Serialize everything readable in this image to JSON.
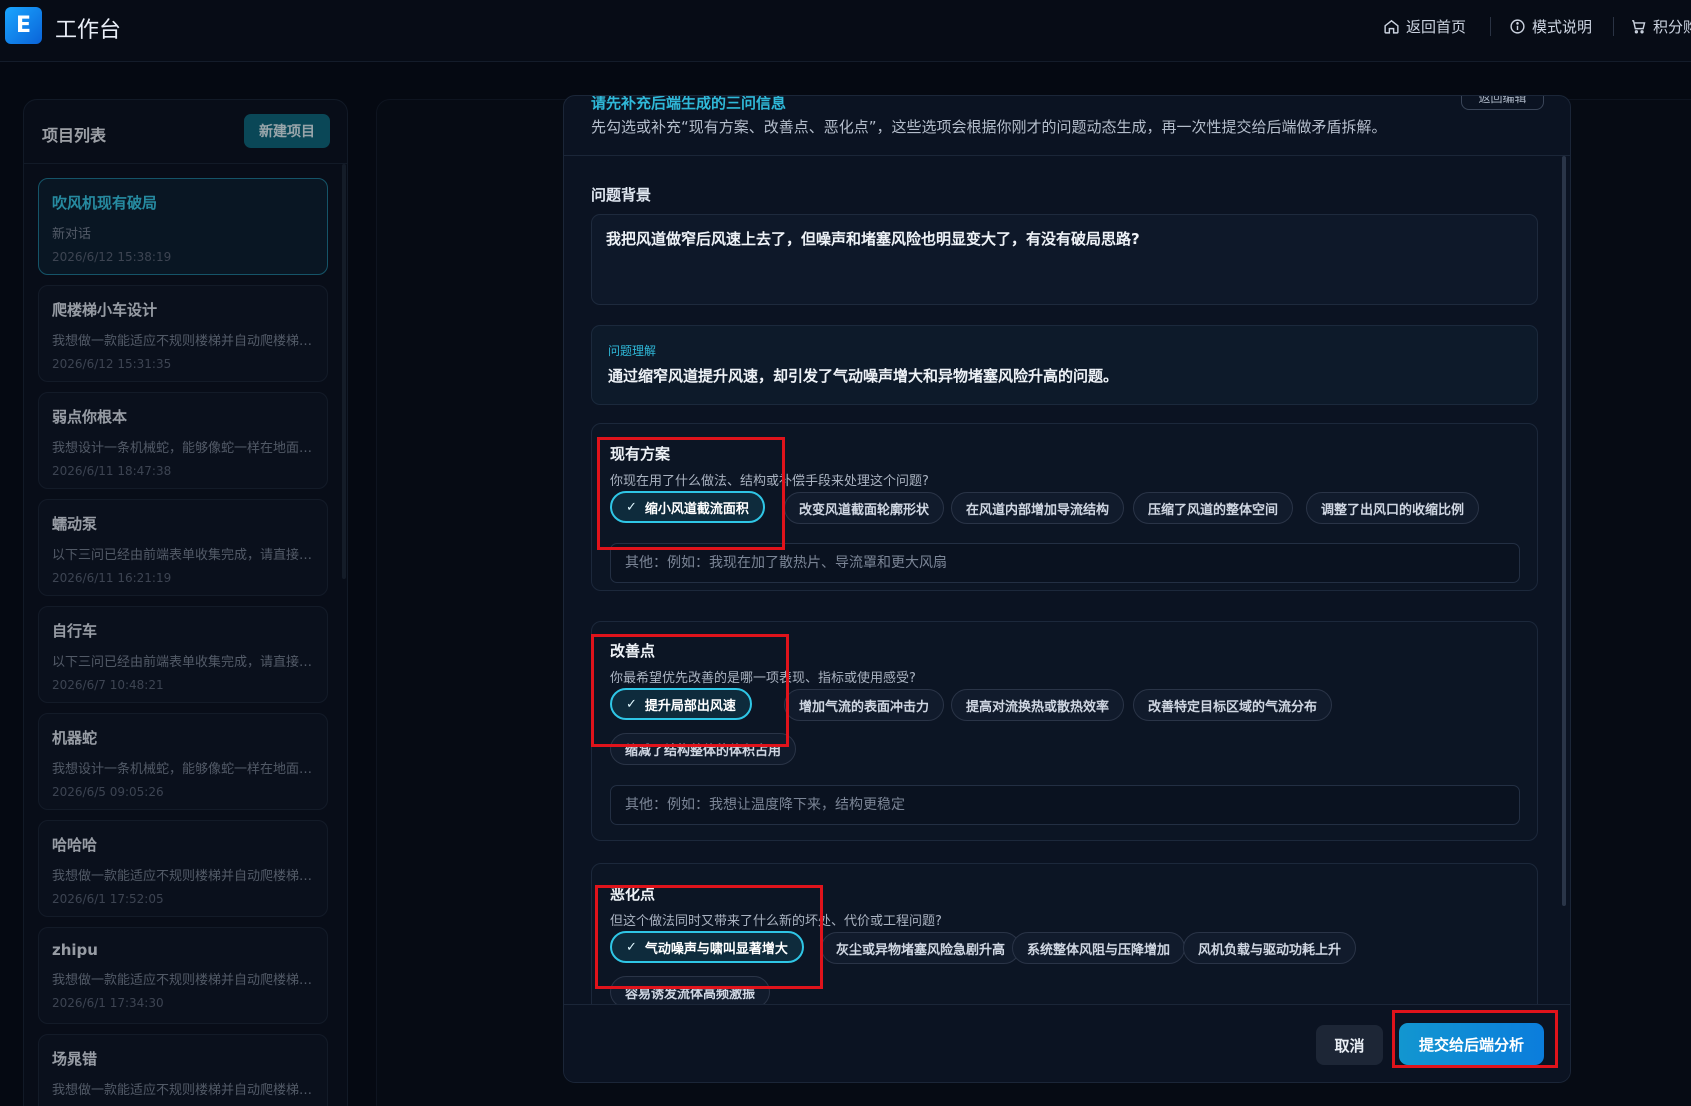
{
  "header": {
    "logo_letter": "E",
    "title": "工作台",
    "nav": {
      "home": "返回首页",
      "mode": "模式说明",
      "points": "积分购"
    }
  },
  "sidebar": {
    "title": "项目列表",
    "new_button": "新建项目",
    "projects": [
      {
        "name": "吹风机现有破局",
        "desc": "新对话",
        "time": "2026/6/12 15:38:19"
      },
      {
        "name": "爬楼梯小车设计",
        "desc": "我想做一款能适应不规则楼梯并自动爬楼梯的小车…",
        "time": "2026/6/12 15:31:35"
      },
      {
        "name": "弱点你根本",
        "desc": "我想设计一条机械蛇，能够像蛇一样在地面上爬行…",
        "time": "2026/6/11 18:47:38"
      },
      {
        "name": "蠕动泵",
        "desc": "以下三问已经由前端表单收集完成，请直接进入分析…",
        "time": "2026/6/11 16:21:19"
      },
      {
        "name": "自行车",
        "desc": "以下三问已经由前端表单收集完成，请直接进入分析…",
        "time": "2026/6/7 10:48:21"
      },
      {
        "name": "机器蛇",
        "desc": "我想设计一条机械蛇，能够像蛇一样在地面上爬行…",
        "time": "2026/6/5 09:05:26"
      },
      {
        "name": "哈哈哈",
        "desc": "我想做一款能适应不规则楼梯并自动爬楼梯的小车…",
        "time": "2026/6/1 17:52:05"
      },
      {
        "name": "zhipu",
        "desc": "我想做一款能适应不规则楼梯并自动爬楼梯的小车…",
        "time": "2026/6/1 17:34:30"
      },
      {
        "name": "场晁错",
        "desc": "我想做一款能适应不规则楼梯并自动爬楼梯的小车…",
        "time": ""
      }
    ]
  },
  "modal": {
    "subtitle_cut": "请先补充后端生成的三问信息",
    "back_edit": "返回编辑",
    "hint": "先勾选或补充“现有方案、改善点、恶化点”，这些选项会根据你刚才的问题动态生成，再一次性提交给后端做矛盾拆解。",
    "background_label": "问题背景",
    "background_text": "我把风道做窄后风速上去了，但噪声和堵塞风险也明显变大了，有没有破局思路?",
    "understanding_label": "问题理解",
    "understanding_text": "通过缩窄风道提升风速，却引发了气动噪声增大和异物堵塞风险升高的问题。",
    "sections": {
      "current": {
        "title": "现有方案",
        "question": "你现在用了什么做法、结构或补偿手段来处理这个问题?",
        "options": [
          "缩小风道截流面积",
          "改变风道截面轮廓形状",
          "在风道内部增加导流结构",
          "压缩了风道的整体空间",
          "调整了出风口的收缩比例"
        ],
        "placeholder": "其他：例如：我现在加了散热片、导流罩和更大风扇"
      },
      "improve": {
        "title": "改善点",
        "question": "你最希望优先改善的是哪一项表现、指标或使用感受?",
        "options": [
          "提升局部出风速",
          "增加气流的表面冲击力",
          "提高对流换热或散热效率",
          "改善特定目标区域的气流分布",
          "缩减了结构整体的体积占用"
        ],
        "placeholder": "其他：例如：我想让温度降下来，结构更稳定"
      },
      "worsen": {
        "title": "恶化点",
        "question": "但这个做法同时又带来了什么新的坏处、代价或工程问题?",
        "options": [
          "气动噪声与啸叫显著增大",
          "灰尘或异物堵塞风险急剧升高",
          "系统整体风阻与压降增加",
          "风机负载与驱动功耗上升",
          "容易诱发流体高频激振"
        ]
      }
    },
    "check_mark": "✓",
    "cancel": "取消",
    "submit": "提交给后端分析"
  },
  "colors": {
    "accent": "#2fc6e6",
    "highlight": "#e0131b",
    "submit": "#0b7ddc"
  }
}
